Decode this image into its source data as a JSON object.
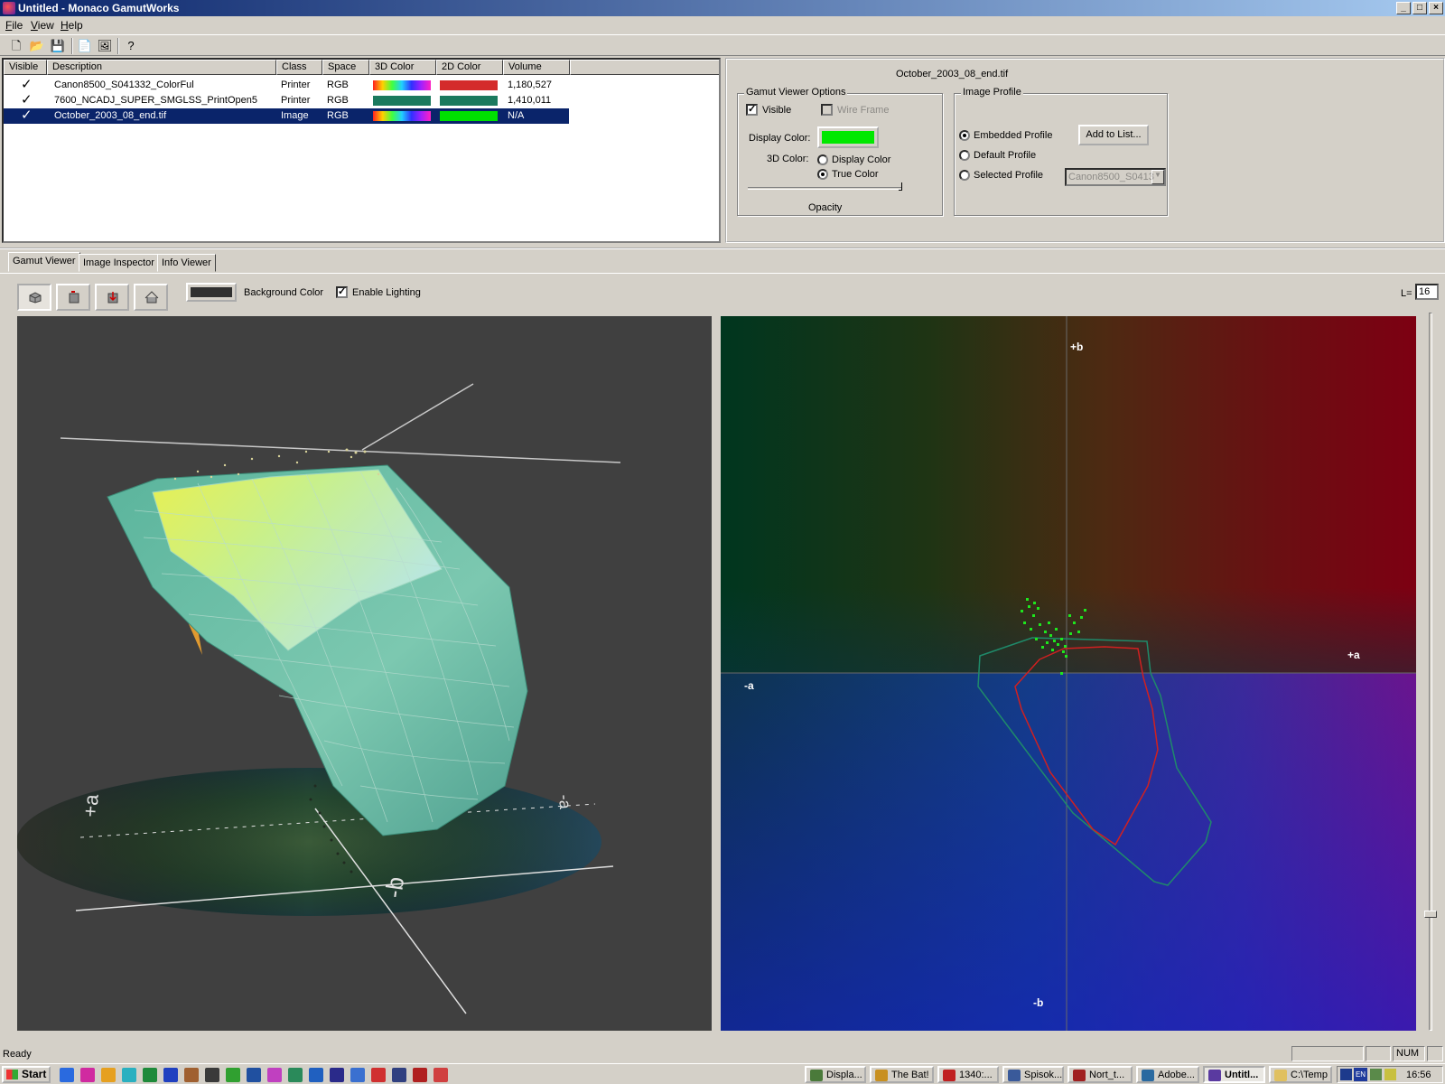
{
  "window": {
    "title": "Untitled - Monaco GamutWorks"
  },
  "menu": [
    "File",
    "View",
    "Help"
  ],
  "profile_list": {
    "columns": [
      "Visible",
      "Description",
      "Class",
      "Space",
      "3D Color",
      "2D Color",
      "Volume"
    ],
    "rows": [
      {
        "visible": true,
        "description": "Canon8500_S041332_ColorFul",
        "class": "Printer",
        "space": "RGB",
        "color3d": "spectrum",
        "color2d": "#d42b2b",
        "volume": "1,180,527",
        "selected": false
      },
      {
        "visible": true,
        "description": "7600_NCADJ_SUPER_SMGLSS_PrintOpen5",
        "class": "Printer",
        "space": "RGB",
        "color3d": "#1b7a5e",
        "color2d": "#1b7a5e",
        "volume": "1,410,011",
        "selected": false
      },
      {
        "visible": true,
        "description": "October_2003_08_end.tif",
        "class": "Image",
        "space": "RGB",
        "color3d": "spectrum",
        "color2d": "#00e000",
        "volume": "N/A",
        "selected": true
      }
    ]
  },
  "options_panel": {
    "file_name": "October_2003_08_end.tif",
    "gamut_viewer_options": {
      "title": "Gamut Viewer Options",
      "visible_label": "Visible",
      "visible_checked": true,
      "wire_frame_label": "Wire Frame",
      "wire_frame_checked": false,
      "display_color_label": "Display Color:",
      "display_color": "#00e800",
      "color3d_label": "3D Color:",
      "color3d_options": [
        "Display Color",
        "True Color"
      ],
      "color3d_selected": "True Color",
      "opacity_label": "Opacity"
    },
    "image_profile": {
      "title": "Image Profile",
      "options": [
        "Embedded Profile",
        "Default Profile",
        "Selected Profile"
      ],
      "selected": "Embedded Profile",
      "add_button": "Add to List...",
      "profile_dropdown_value": "Canon8500_S0413"
    }
  },
  "tabs": [
    "Gamut Viewer",
    "Image Inspector",
    "Info Viewer"
  ],
  "active_tab": "Gamut Viewer",
  "viewer_toolbar": {
    "background_color_label": "Background Color",
    "background_color": "#303030",
    "enable_lighting_label": "Enable Lighting",
    "enable_lighting_checked": true,
    "l_label": "L=",
    "l_value": "16"
  },
  "plot2d": {
    "axis_labels": {
      "pos_b": "+b",
      "neg_b": "-b",
      "pos_a": "+a",
      "neg_a": "-a"
    }
  },
  "status": {
    "text": "Ready",
    "num": "NUM"
  },
  "taskbar": {
    "start": "Start",
    "tasks": [
      "Displa...",
      "The Bat!",
      "1340:...",
      "Spisok...",
      "Nort_t...",
      "Adobe...",
      "Untitl...",
      "C:\\Temp"
    ],
    "active_task": "Untitl...",
    "tray_lang": "EN",
    "clock": "16:56"
  }
}
